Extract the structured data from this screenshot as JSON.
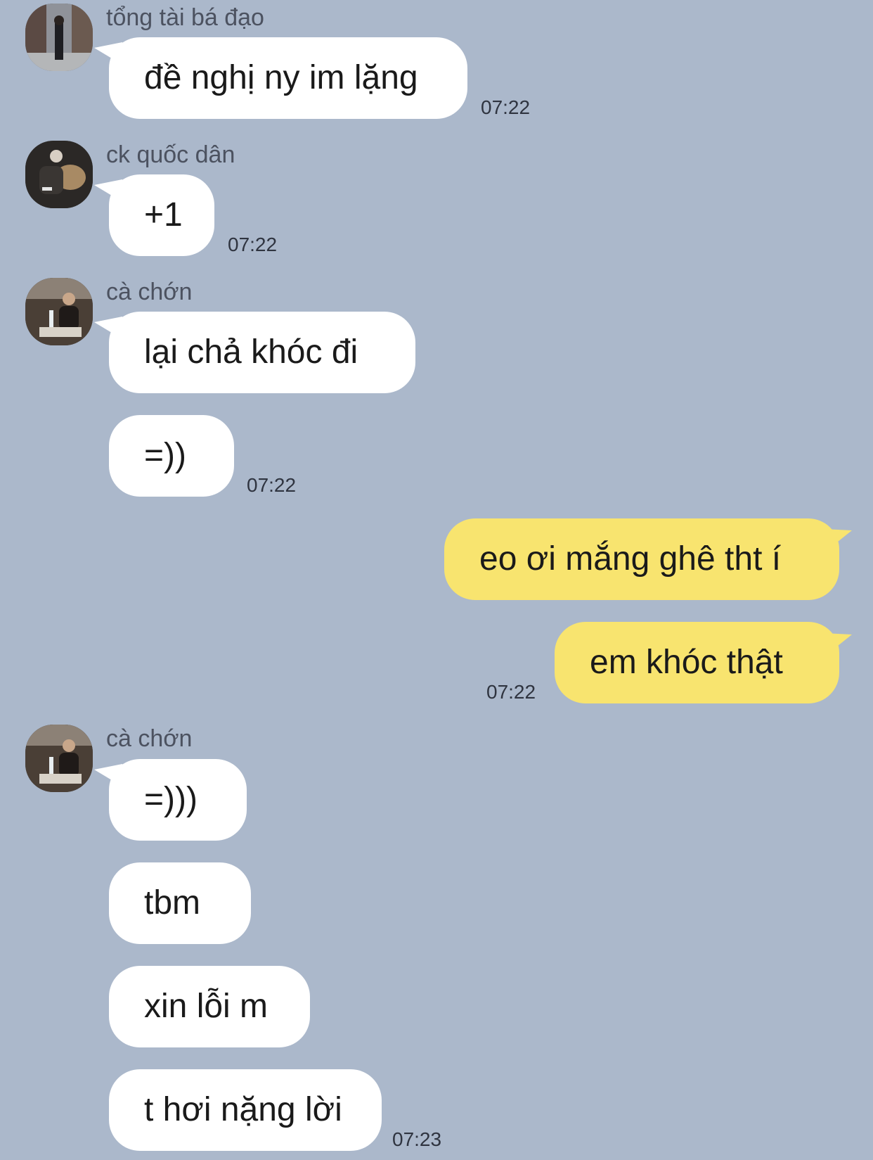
{
  "colors": {
    "background": "#abb8cb",
    "incoming_bubble": "#ffffff",
    "outgoing_bubble": "#f8e46f"
  },
  "messages": [
    {
      "sender": "tổng tài bá đạo",
      "avatar_icon": "street-photo-avatar-icon",
      "texts": [
        "đề nghị ny im lặng"
      ],
      "time": "07:22"
    },
    {
      "sender": "ck quốc dân",
      "avatar_icon": "dog-photo-avatar-icon",
      "texts": [
        "+1"
      ],
      "time": "07:22"
    },
    {
      "sender": "cà chớn",
      "avatar_icon": "restaurant-photo-avatar-icon",
      "texts": [
        "lại chả khóc đi",
        "=))"
      ],
      "time": "07:22"
    },
    {
      "sender": "",
      "outgoing": true,
      "texts": [
        "eo ơi mắng ghê tht í",
        "em khóc thật"
      ],
      "time": "07:22"
    },
    {
      "sender": "cà chớn",
      "avatar_icon": "restaurant-photo-avatar-icon",
      "texts": [
        "=)))",
        "tbm",
        "xin lỗi m",
        "t hơi nặng lời"
      ],
      "time": "07:23"
    }
  ]
}
